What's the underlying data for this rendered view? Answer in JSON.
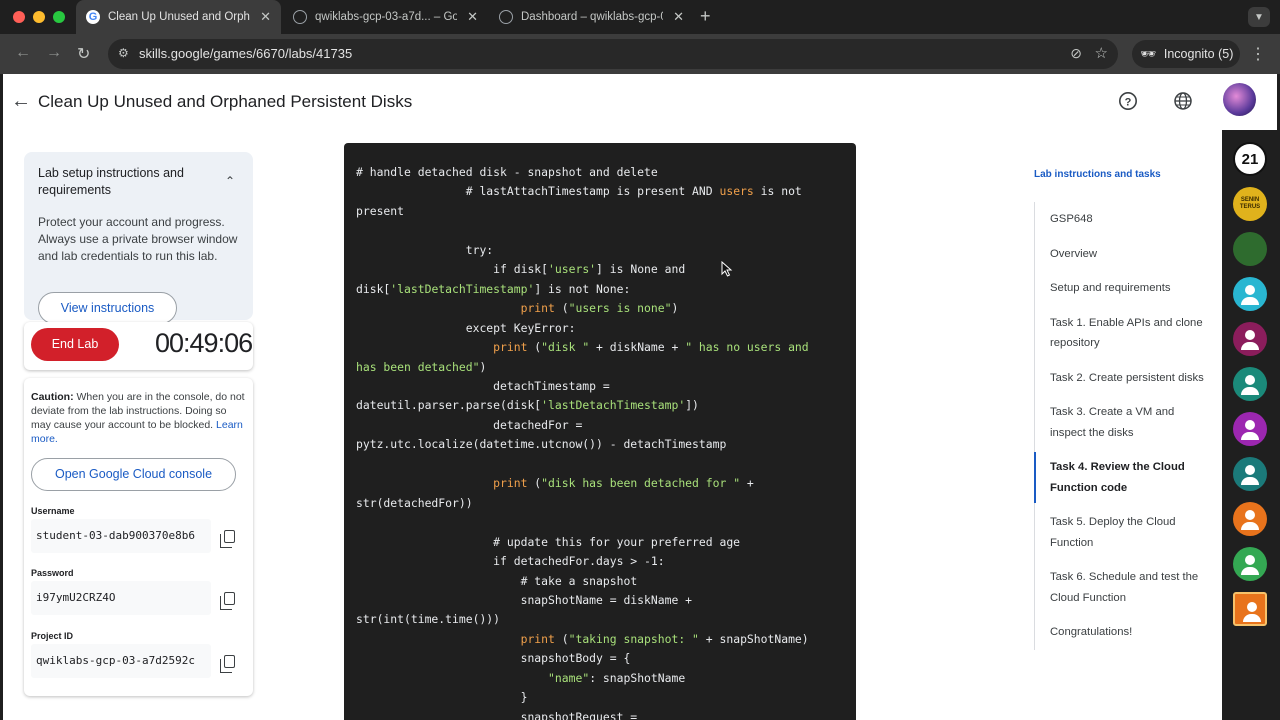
{
  "browser": {
    "tabs": [
      {
        "title": "Clean Up Unused and Orphaned Persistent Disks",
        "active": true,
        "icon": "google-g-icon"
      },
      {
        "title": "qwiklabs-gcp-03-a7d... – Go",
        "active": false,
        "icon": "cloud-icon"
      },
      {
        "title": "Dashboard – qwiklabs-gcp-0",
        "active": false,
        "icon": "cloud-icon"
      }
    ],
    "url": "skills.google/games/6670/labs/41735",
    "incognito_label": "Incognito (5)"
  },
  "header": {
    "title": "Clean Up Unused and Orphaned Persistent Disks"
  },
  "setup": {
    "heading": "Lab setup instructions and requirements",
    "body": "Protect your account and progress. Always use a private browser window and lab credentials to run this lab.",
    "view_button": "View instructions"
  },
  "timer": {
    "end_label": "End Lab",
    "time": "00:49:06"
  },
  "credentials": {
    "caution_bold": "Caution:",
    "caution_text": " When you are in the console, do not deviate from the lab instructions. Doing so may cause your account to be blocked.",
    "learn_more": "Learn more.",
    "console_button": "Open Google Cloud console",
    "username_label": "Username",
    "username": "student-03-dab900370e8b6",
    "password_label": "Password",
    "password": "i97ymU2CRZ4O",
    "project_label": "Project ID",
    "project": "qwiklabs-gcp-03-a7d2592c"
  },
  "toc": {
    "heading": "Lab instructions and tasks",
    "items": [
      "GSP648",
      "Overview",
      "Setup and requirements",
      "Task 1. Enable APIs and clone repository",
      "Task 2. Create persistent disks",
      "Task 3. Create a VM and inspect the disks",
      "Task 4. Review the Cloud Function code",
      "Task 5. Deploy the Cloud Function",
      "Task 6. Schedule and test the Cloud Function",
      "Congratulations!"
    ],
    "active_index": 6
  },
  "strip": {
    "avatars": [
      {
        "label": "21",
        "color": "#111111"
      },
      {
        "label": "SENIN TERUS",
        "color": "#e0b21c"
      },
      {
        "label": "",
        "color": "#2e6b2e"
      },
      {
        "label": "",
        "color": "#29b6d1"
      },
      {
        "label": "",
        "color": "#8b1d5c"
      },
      {
        "label": "",
        "color": "#1b8a7a"
      },
      {
        "label": "",
        "color": "#9c27b0"
      },
      {
        "label": "",
        "color": "#1b7a7a"
      },
      {
        "label": "",
        "color": "#e8731c"
      },
      {
        "label": "",
        "color": "#34a853"
      },
      {
        "label": "",
        "color": "#e8731c"
      }
    ]
  }
}
